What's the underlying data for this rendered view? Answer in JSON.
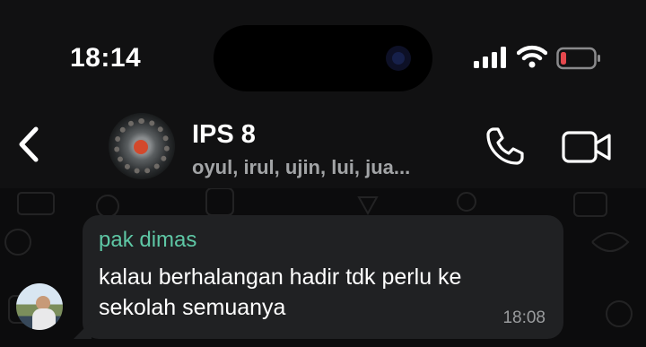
{
  "status_bar": {
    "time": "18:14",
    "icons": [
      "cellular-signal-icon",
      "wifi-icon",
      "battery-low-icon"
    ],
    "battery_color": "#e5484d"
  },
  "header": {
    "title": "IPS 8",
    "subtitle": "oyul, irul, ujin, lui, jua...",
    "icons": [
      "back-chevron-icon",
      "phone-icon",
      "video-camera-icon"
    ]
  },
  "chat": {
    "messages": [
      {
        "sender": "pak dimas",
        "text": "kalau berhalangan hadir tdk perlu ke sekolah semuanya",
        "time": "18:08",
        "sender_color": "#5ec7a5"
      }
    ]
  }
}
